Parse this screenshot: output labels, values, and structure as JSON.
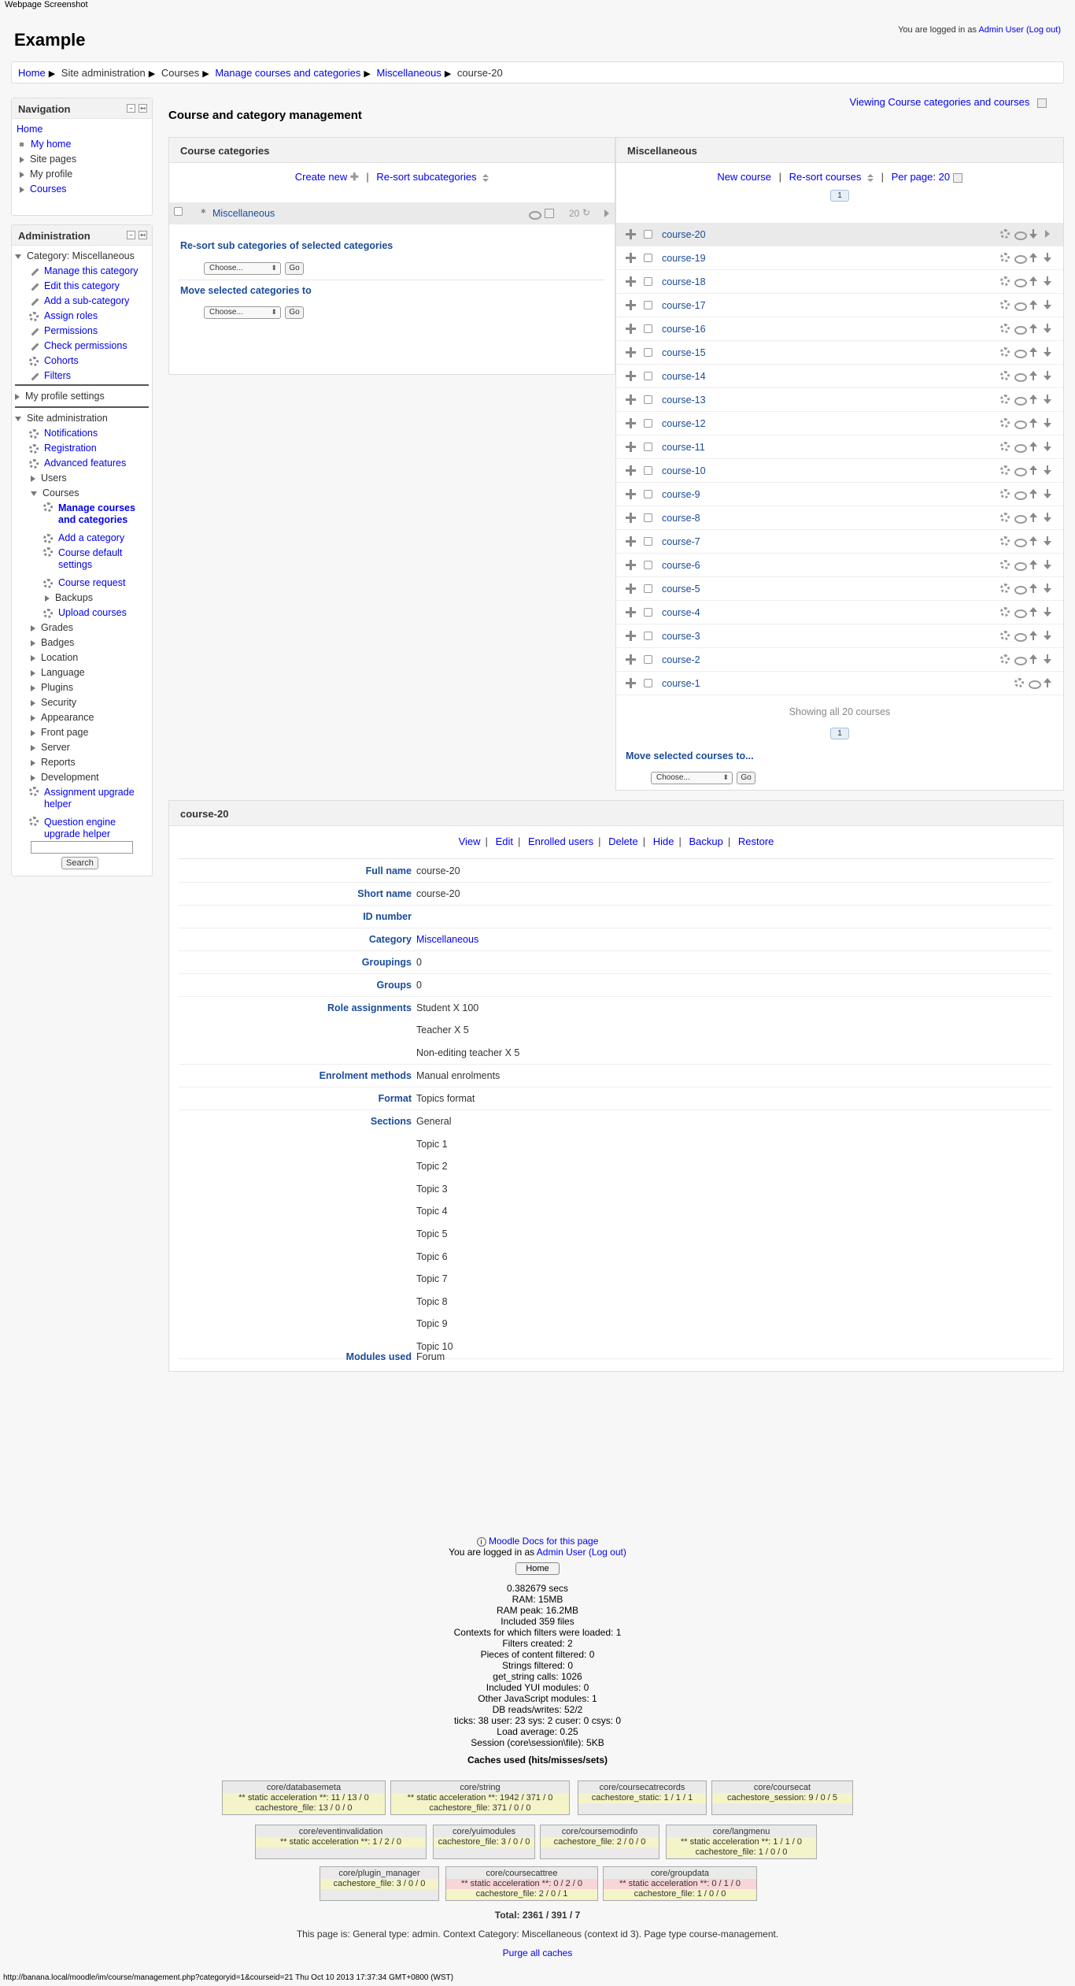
{
  "window": {
    "title": "Webpage Screenshot"
  },
  "header": {
    "site_name": "Example",
    "login_prefix": "You are logged in as",
    "user": "Admin User",
    "logout": "(Log out)"
  },
  "breadcrumb": [
    "Home",
    "Site administration",
    "Courses",
    "Manage courses and categories",
    "Miscellaneous",
    "course-20"
  ],
  "navigation": {
    "title": "Navigation",
    "items": [
      "Home",
      "My home",
      "Site pages",
      "My profile",
      "Courses"
    ]
  },
  "administration": {
    "title": "Administration",
    "category_label": "Category: Miscellaneous",
    "category_items": [
      "Manage this category",
      "Edit this category",
      "Add a sub-category",
      "Assign roles",
      "Permissions",
      "Check permissions",
      "Cohorts",
      "Filters"
    ],
    "my_profile_settings": "My profile settings",
    "site_admin": "Site administration",
    "site_admin_items": [
      "Notifications",
      "Registration",
      "Advanced features",
      "Users",
      "Courses"
    ],
    "courses_items": [
      "Manage courses and categories",
      "Add a category",
      "Course default settings",
      "Course request",
      "Backups",
      "Upload courses"
    ],
    "more_items": [
      "Grades",
      "Badges",
      "Location",
      "Language",
      "Plugins",
      "Security",
      "Appearance",
      "Front page",
      "Server",
      "Reports",
      "Development",
      "Assignment upgrade helper",
      "Question engine upgrade helper"
    ],
    "search_button": "Search"
  },
  "main": {
    "title": "Course and category management",
    "viewing": "Viewing Course categories and courses"
  },
  "categories_panel": {
    "title": "Course categories",
    "create_new": "Create new",
    "resort": "Re-sort subcategories",
    "category_name": "Miscellaneous",
    "category_count": "20",
    "resort_selected_heading": "Re-sort sub categories of selected categories",
    "move_selected_heading": "Move selected categories to",
    "choose": "Choose...",
    "go": "Go"
  },
  "courses_panel": {
    "title": "Miscellaneous",
    "new_course": "New course",
    "resort_courses": "Re-sort courses",
    "per_page": "Per page: 20",
    "page": "1",
    "courses": [
      "course-20",
      "course-19",
      "course-18",
      "course-17",
      "course-16",
      "course-15",
      "course-14",
      "course-13",
      "course-12",
      "course-11",
      "course-10",
      "course-9",
      "course-8",
      "course-7",
      "course-6",
      "course-5",
      "course-4",
      "course-3",
      "course-2",
      "course-1"
    ],
    "showing": "Showing all 20 courses",
    "move_selected": "Move selected courses to...",
    "choose": "Choose...",
    "go": "Go"
  },
  "detail": {
    "title": "course-20",
    "actions": [
      "View",
      "Edit",
      "Enrolled users",
      "Delete",
      "Hide",
      "Backup",
      "Restore"
    ],
    "full_name_label": "Full name",
    "full_name": "course-20",
    "short_name_label": "Short name",
    "short_name": "course-20",
    "id_number_label": "ID number",
    "category_label": "Category",
    "category": "Miscellaneous",
    "groupings_label": "Groupings",
    "groupings": "0",
    "groups_label": "Groups",
    "groups": "0",
    "roles_label": "Role assignments",
    "roles": [
      "Student X 100",
      "Teacher X 5",
      "Non-editing teacher X 5"
    ],
    "enrol_label": "Enrolment methods",
    "enrol": "Manual enrolments",
    "format_label": "Format",
    "format": "Topics format",
    "sections_label": "Sections",
    "sections": [
      "General",
      "Topic 1",
      "Topic 2",
      "Topic 3",
      "Topic 4",
      "Topic 5",
      "Topic 6",
      "Topic 7",
      "Topic 8",
      "Topic 9",
      "Topic 10"
    ],
    "modules_label": "Modules used",
    "modules": "Forum"
  },
  "footer": {
    "docs": "Moodle Docs for this page",
    "logged_prefix": "You are logged in as",
    "user": "Admin User",
    "logout": "(Log out)",
    "home_button": "Home",
    "perf": [
      "0.382679 secs",
      "RAM: 15MB",
      "RAM peak: 16.2MB",
      "Included 359 files",
      "Contexts for which filters were loaded: 1",
      "Filters created: 2",
      "Pieces of content filtered: 0",
      "Strings filtered: 0",
      "get_string calls: 1026",
      "Included YUI modules: 0",
      "Other JavaScript modules: 1",
      "DB reads/writes: 52/2",
      "ticks: 38 user: 23 sys: 2 cuser: 0 csys: 0",
      "Load average: 0.25",
      "Session (core\\session\\file): 5KB"
    ],
    "caches_title": "Caches used (hits/misses/sets)",
    "caches": [
      {
        "name": "core/databasemeta",
        "lines": [
          "** static acceleration **: 11 / 13 / 0",
          "cachestore_file: 13 / 0 / 0"
        ],
        "kinds": [
          "hit",
          "hit"
        ]
      },
      {
        "name": "core/string",
        "lines": [
          "** static acceleration **: 1942 / 371 / 0",
          "cachestore_file: 371 / 0 / 0"
        ],
        "kinds": [
          "hit",
          "hit"
        ]
      },
      {
        "name": "core/coursecatrecords",
        "lines": [
          "cachestore_static: 1 / 1 / 1"
        ],
        "kinds": [
          "hit"
        ]
      },
      {
        "name": "core/coursecat",
        "lines": [
          "cachestore_session: 9 / 0 / 5"
        ],
        "kinds": [
          "hit"
        ]
      },
      {
        "name": "core/eventinvalidation",
        "lines": [
          "** static acceleration **: 1 / 2 / 0"
        ],
        "kinds": [
          "hit"
        ]
      },
      {
        "name": "core/yuimodules",
        "lines": [
          "cachestore_file: 3 / 0 / 0"
        ],
        "kinds": [
          "hit"
        ]
      },
      {
        "name": "core/coursemodinfo",
        "lines": [
          "cachestore_file: 2 / 0 / 0"
        ],
        "kinds": [
          "hit"
        ]
      },
      {
        "name": "core/langmenu",
        "lines": [
          "** static acceleration **: 1 / 1 / 0",
          "cachestore_file: 1 / 0 / 0"
        ],
        "kinds": [
          "hit",
          "hit"
        ]
      },
      {
        "name": "core/plugin_manager",
        "lines": [
          "cachestore_file: 3 / 0 / 0"
        ],
        "kinds": [
          "hit"
        ]
      },
      {
        "name": "core/coursecattree",
        "lines": [
          "** static acceleration **: 0 / 2 / 0",
          "cachestore_file: 2 / 0 / 1"
        ],
        "kinds": [
          "miss",
          "hit"
        ]
      },
      {
        "name": "core/groupdata",
        "lines": [
          "** static acceleration **: 0 / 1 / 0",
          "cachestore_file: 1 / 0 / 0"
        ],
        "kinds": [
          "miss",
          "hit"
        ]
      }
    ],
    "total": "Total: 2361 / 391 / 7",
    "page_info": "This page is: General type: admin. Context Category: Miscellaneous (context id 3). Page type course-management.",
    "purge": "Purge all caches",
    "status_url": "http://banana.local/moodle/im/course/management.php?categoryid=1&courseid=21 Thu Oct 10 2013 17:37:34 GMT+0800 (WST)"
  },
  "colors": {
    "link": "#0000ee",
    "label_blue": "#1a4c99",
    "hit": "#f4f4c8",
    "miss": "#f8d5d9"
  }
}
